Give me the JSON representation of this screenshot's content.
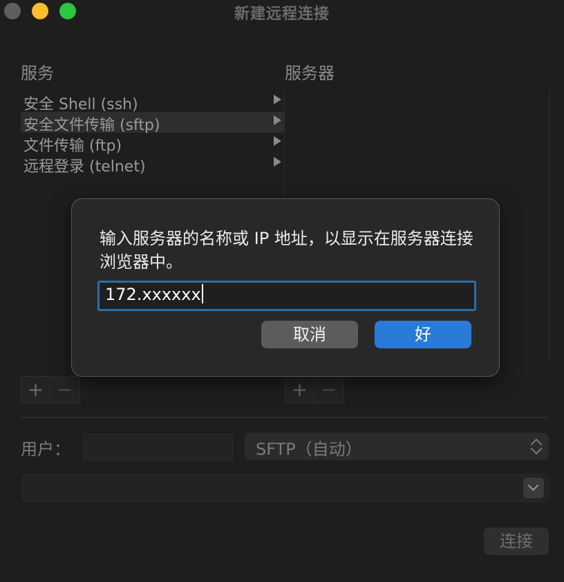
{
  "window": {
    "title": "新建远程连接"
  },
  "services": {
    "heading": "服务",
    "items": [
      {
        "label": "安全 Shell (ssh)"
      },
      {
        "label": "安全文件传输 (sftp)"
      },
      {
        "label": "文件传输 (ftp)"
      },
      {
        "label": "远程登录 (telnet)"
      }
    ],
    "selected_index": 1
  },
  "servers": {
    "heading": "服务器"
  },
  "controls": {
    "add_symbol": "+",
    "remove_symbol": "−"
  },
  "user": {
    "label": "用户：",
    "value": ""
  },
  "protocol": {
    "selected": "SFTP（自动）"
  },
  "address": {
    "value": ""
  },
  "connect_label": "连接",
  "dialog": {
    "message": "输入服务器的名称或 IP 地址，以显示在服务器连接浏览器中。",
    "input_value": "172.xxxxxx",
    "cancel_label": "取消",
    "ok_label": "好"
  },
  "colors": {
    "accent": "#2a7ad9",
    "focus_ring": "#2d6ea8",
    "traffic_close": "#5e5e5e",
    "traffic_min": "#febc2e",
    "traffic_max": "#28c840"
  }
}
